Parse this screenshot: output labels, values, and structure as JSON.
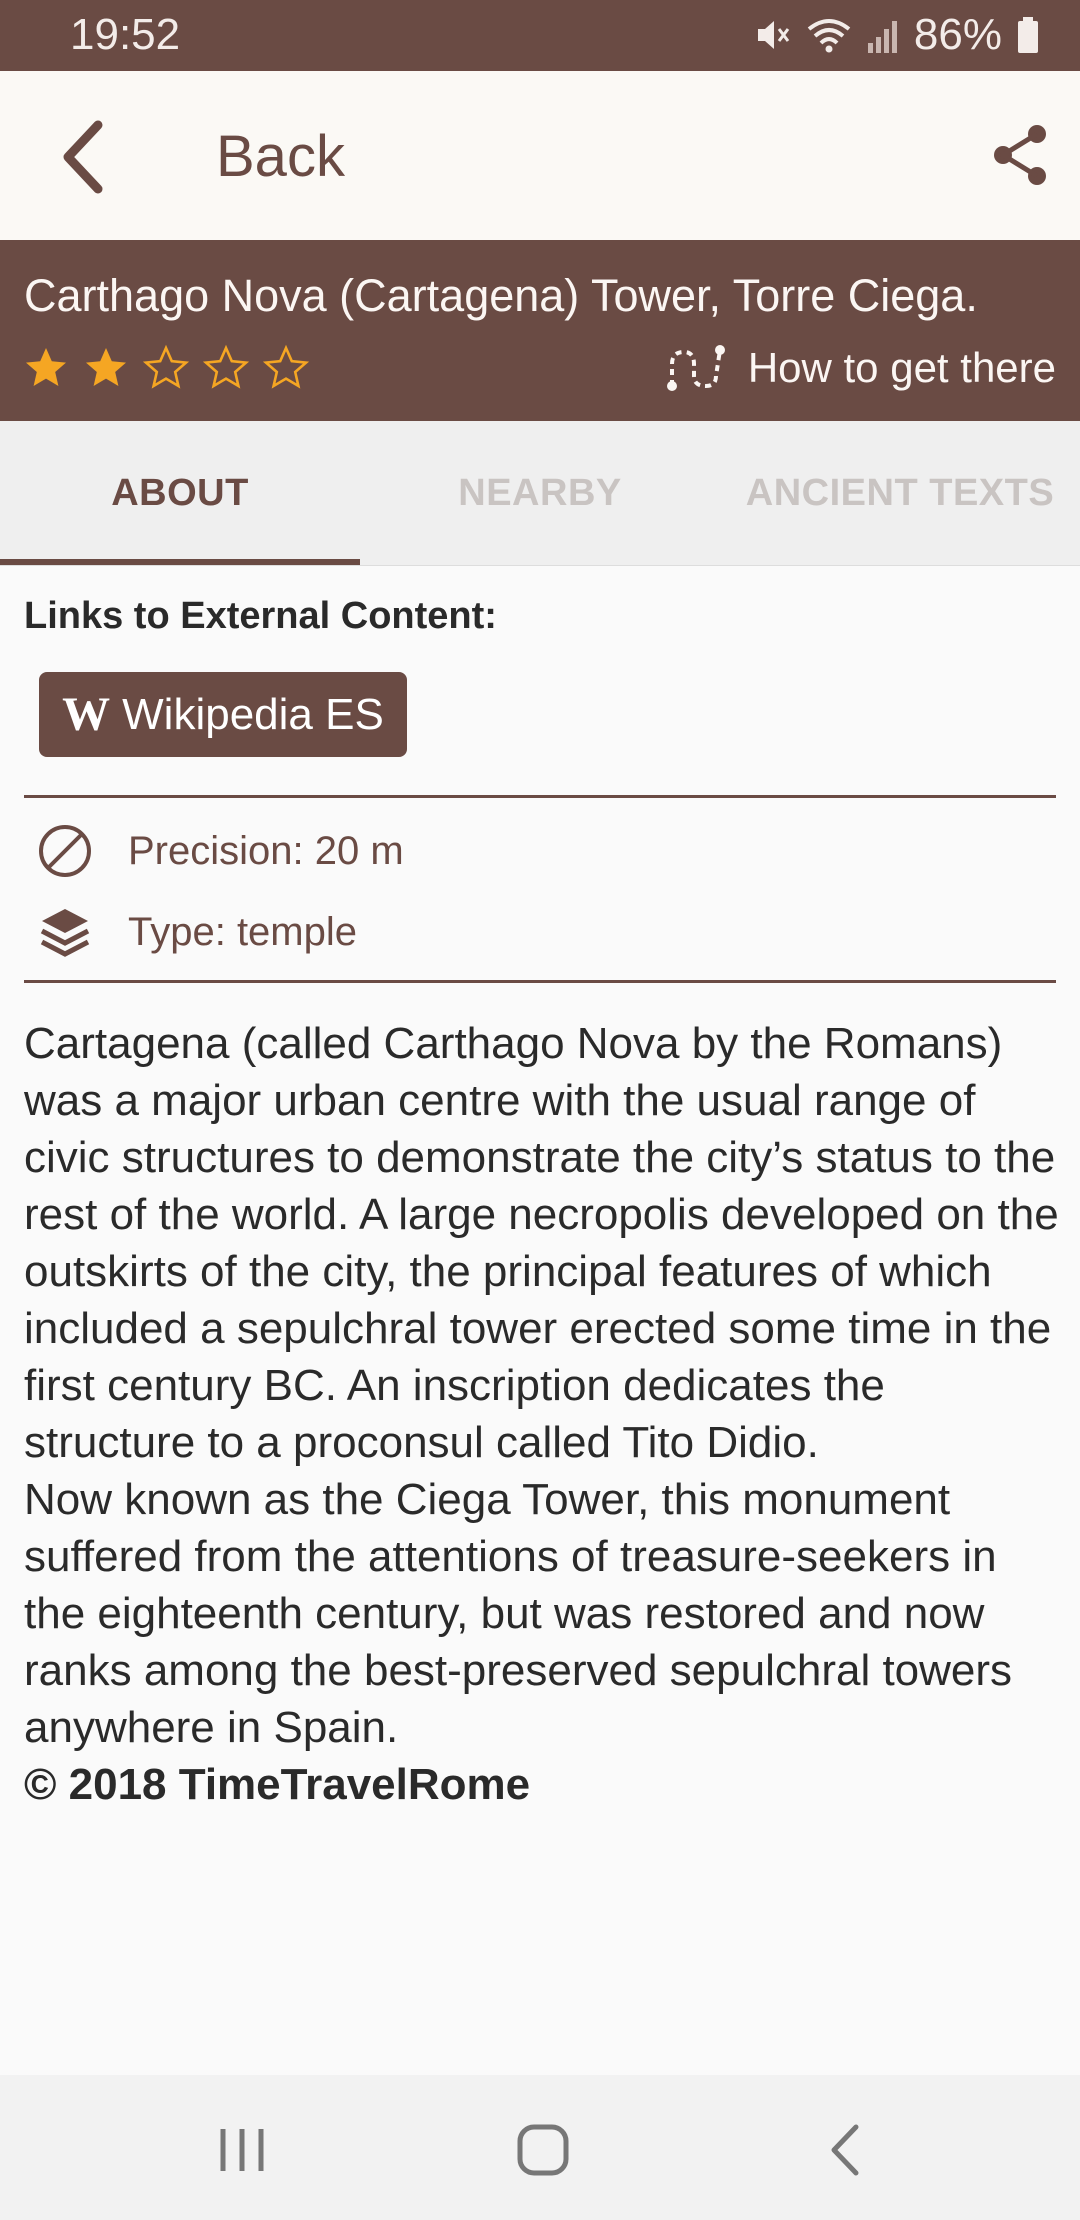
{
  "status_bar": {
    "time": "19:52",
    "battery": "86%",
    "icons": [
      "mute-icon",
      "wifi-icon",
      "signal-icon",
      "battery-icon"
    ]
  },
  "app_bar": {
    "back_label": "Back",
    "back_icon": "chevron-left-icon",
    "share_icon": "share-icon"
  },
  "header": {
    "title": "Carthago Nova (Cartagena) Tower, Torre Ciega.",
    "rating": 2,
    "rating_max": 5,
    "directions_label": "How to get there",
    "directions_icon": "route-icon"
  },
  "tabs": [
    {
      "label": "ABOUT",
      "active": true
    },
    {
      "label": "NEARBY",
      "active": false
    },
    {
      "label": "ANCIENT TEXTS",
      "active": false
    }
  ],
  "about": {
    "links_heading": "Links to External Content:",
    "wiki_button_icon_text": "W",
    "wiki_button_label": "Wikipedia ES",
    "precision": "Precision: 20 m",
    "type": "Type: temple",
    "description_p1": "Cartagena (called Carthago Nova by the Romans) was a major urban centre with the usual range of civic structures to demonstrate the city’s status to the rest of the world. A large necropolis developed on the outskirts of the city, the principal features of which included a sepulchral tower erected some time in the first century BC. An inscription dedicates the structure to a proconsul called Tito Didio.",
    "description_p2": "Now known as the Ciega Tower, this monument suffered from the attentions of treasure-seekers in the eighteenth century, but was restored and now ranks among the best-preserved sepulchral towers anywhere in Spain.",
    "copyright": "© 2018 TimeTravelRome"
  },
  "colors": {
    "brand": "#6a4b44",
    "star": "#f5a623",
    "inactive_tab": "#c9c4c2"
  }
}
